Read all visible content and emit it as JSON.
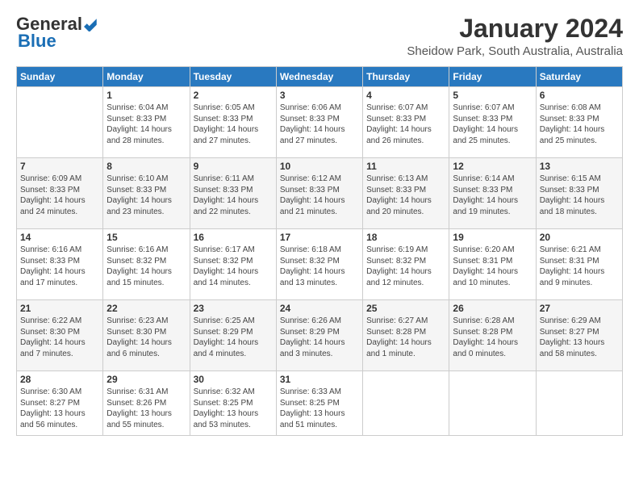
{
  "logo": {
    "general": "General",
    "blue": "Blue"
  },
  "title": "January 2024",
  "location": "Sheidow Park, South Australia, Australia",
  "days_of_week": [
    "Sunday",
    "Monday",
    "Tuesday",
    "Wednesday",
    "Thursday",
    "Friday",
    "Saturday"
  ],
  "weeks": [
    [
      {
        "day": "",
        "info": ""
      },
      {
        "day": "1",
        "info": "Sunrise: 6:04 AM\nSunset: 8:33 PM\nDaylight: 14 hours\nand 28 minutes."
      },
      {
        "day": "2",
        "info": "Sunrise: 6:05 AM\nSunset: 8:33 PM\nDaylight: 14 hours\nand 27 minutes."
      },
      {
        "day": "3",
        "info": "Sunrise: 6:06 AM\nSunset: 8:33 PM\nDaylight: 14 hours\nand 27 minutes."
      },
      {
        "day": "4",
        "info": "Sunrise: 6:07 AM\nSunset: 8:33 PM\nDaylight: 14 hours\nand 26 minutes."
      },
      {
        "day": "5",
        "info": "Sunrise: 6:07 AM\nSunset: 8:33 PM\nDaylight: 14 hours\nand 25 minutes."
      },
      {
        "day": "6",
        "info": "Sunrise: 6:08 AM\nSunset: 8:33 PM\nDaylight: 14 hours\nand 25 minutes."
      }
    ],
    [
      {
        "day": "7",
        "info": "Sunrise: 6:09 AM\nSunset: 8:33 PM\nDaylight: 14 hours\nand 24 minutes."
      },
      {
        "day": "8",
        "info": "Sunrise: 6:10 AM\nSunset: 8:33 PM\nDaylight: 14 hours\nand 23 minutes."
      },
      {
        "day": "9",
        "info": "Sunrise: 6:11 AM\nSunset: 8:33 PM\nDaylight: 14 hours\nand 22 minutes."
      },
      {
        "day": "10",
        "info": "Sunrise: 6:12 AM\nSunset: 8:33 PM\nDaylight: 14 hours\nand 21 minutes."
      },
      {
        "day": "11",
        "info": "Sunrise: 6:13 AM\nSunset: 8:33 PM\nDaylight: 14 hours\nand 20 minutes."
      },
      {
        "day": "12",
        "info": "Sunrise: 6:14 AM\nSunset: 8:33 PM\nDaylight: 14 hours\nand 19 minutes."
      },
      {
        "day": "13",
        "info": "Sunrise: 6:15 AM\nSunset: 8:33 PM\nDaylight: 14 hours\nand 18 minutes."
      }
    ],
    [
      {
        "day": "14",
        "info": "Sunrise: 6:16 AM\nSunset: 8:33 PM\nDaylight: 14 hours\nand 17 minutes."
      },
      {
        "day": "15",
        "info": "Sunrise: 6:16 AM\nSunset: 8:32 PM\nDaylight: 14 hours\nand 15 minutes."
      },
      {
        "day": "16",
        "info": "Sunrise: 6:17 AM\nSunset: 8:32 PM\nDaylight: 14 hours\nand 14 minutes."
      },
      {
        "day": "17",
        "info": "Sunrise: 6:18 AM\nSunset: 8:32 PM\nDaylight: 14 hours\nand 13 minutes."
      },
      {
        "day": "18",
        "info": "Sunrise: 6:19 AM\nSunset: 8:32 PM\nDaylight: 14 hours\nand 12 minutes."
      },
      {
        "day": "19",
        "info": "Sunrise: 6:20 AM\nSunset: 8:31 PM\nDaylight: 14 hours\nand 10 minutes."
      },
      {
        "day": "20",
        "info": "Sunrise: 6:21 AM\nSunset: 8:31 PM\nDaylight: 14 hours\nand 9 minutes."
      }
    ],
    [
      {
        "day": "21",
        "info": "Sunrise: 6:22 AM\nSunset: 8:30 PM\nDaylight: 14 hours\nand 7 minutes."
      },
      {
        "day": "22",
        "info": "Sunrise: 6:23 AM\nSunset: 8:30 PM\nDaylight: 14 hours\nand 6 minutes."
      },
      {
        "day": "23",
        "info": "Sunrise: 6:25 AM\nSunset: 8:29 PM\nDaylight: 14 hours\nand 4 minutes."
      },
      {
        "day": "24",
        "info": "Sunrise: 6:26 AM\nSunset: 8:29 PM\nDaylight: 14 hours\nand 3 minutes."
      },
      {
        "day": "25",
        "info": "Sunrise: 6:27 AM\nSunset: 8:28 PM\nDaylight: 14 hours\nand 1 minute."
      },
      {
        "day": "26",
        "info": "Sunrise: 6:28 AM\nSunset: 8:28 PM\nDaylight: 14 hours\nand 0 minutes."
      },
      {
        "day": "27",
        "info": "Sunrise: 6:29 AM\nSunset: 8:27 PM\nDaylight: 13 hours\nand 58 minutes."
      }
    ],
    [
      {
        "day": "28",
        "info": "Sunrise: 6:30 AM\nSunset: 8:27 PM\nDaylight: 13 hours\nand 56 minutes."
      },
      {
        "day": "29",
        "info": "Sunrise: 6:31 AM\nSunset: 8:26 PM\nDaylight: 13 hours\nand 55 minutes."
      },
      {
        "day": "30",
        "info": "Sunrise: 6:32 AM\nSunset: 8:25 PM\nDaylight: 13 hours\nand 53 minutes."
      },
      {
        "day": "31",
        "info": "Sunrise: 6:33 AM\nSunset: 8:25 PM\nDaylight: 13 hours\nand 51 minutes."
      },
      {
        "day": "",
        "info": ""
      },
      {
        "day": "",
        "info": ""
      },
      {
        "day": "",
        "info": ""
      }
    ]
  ]
}
